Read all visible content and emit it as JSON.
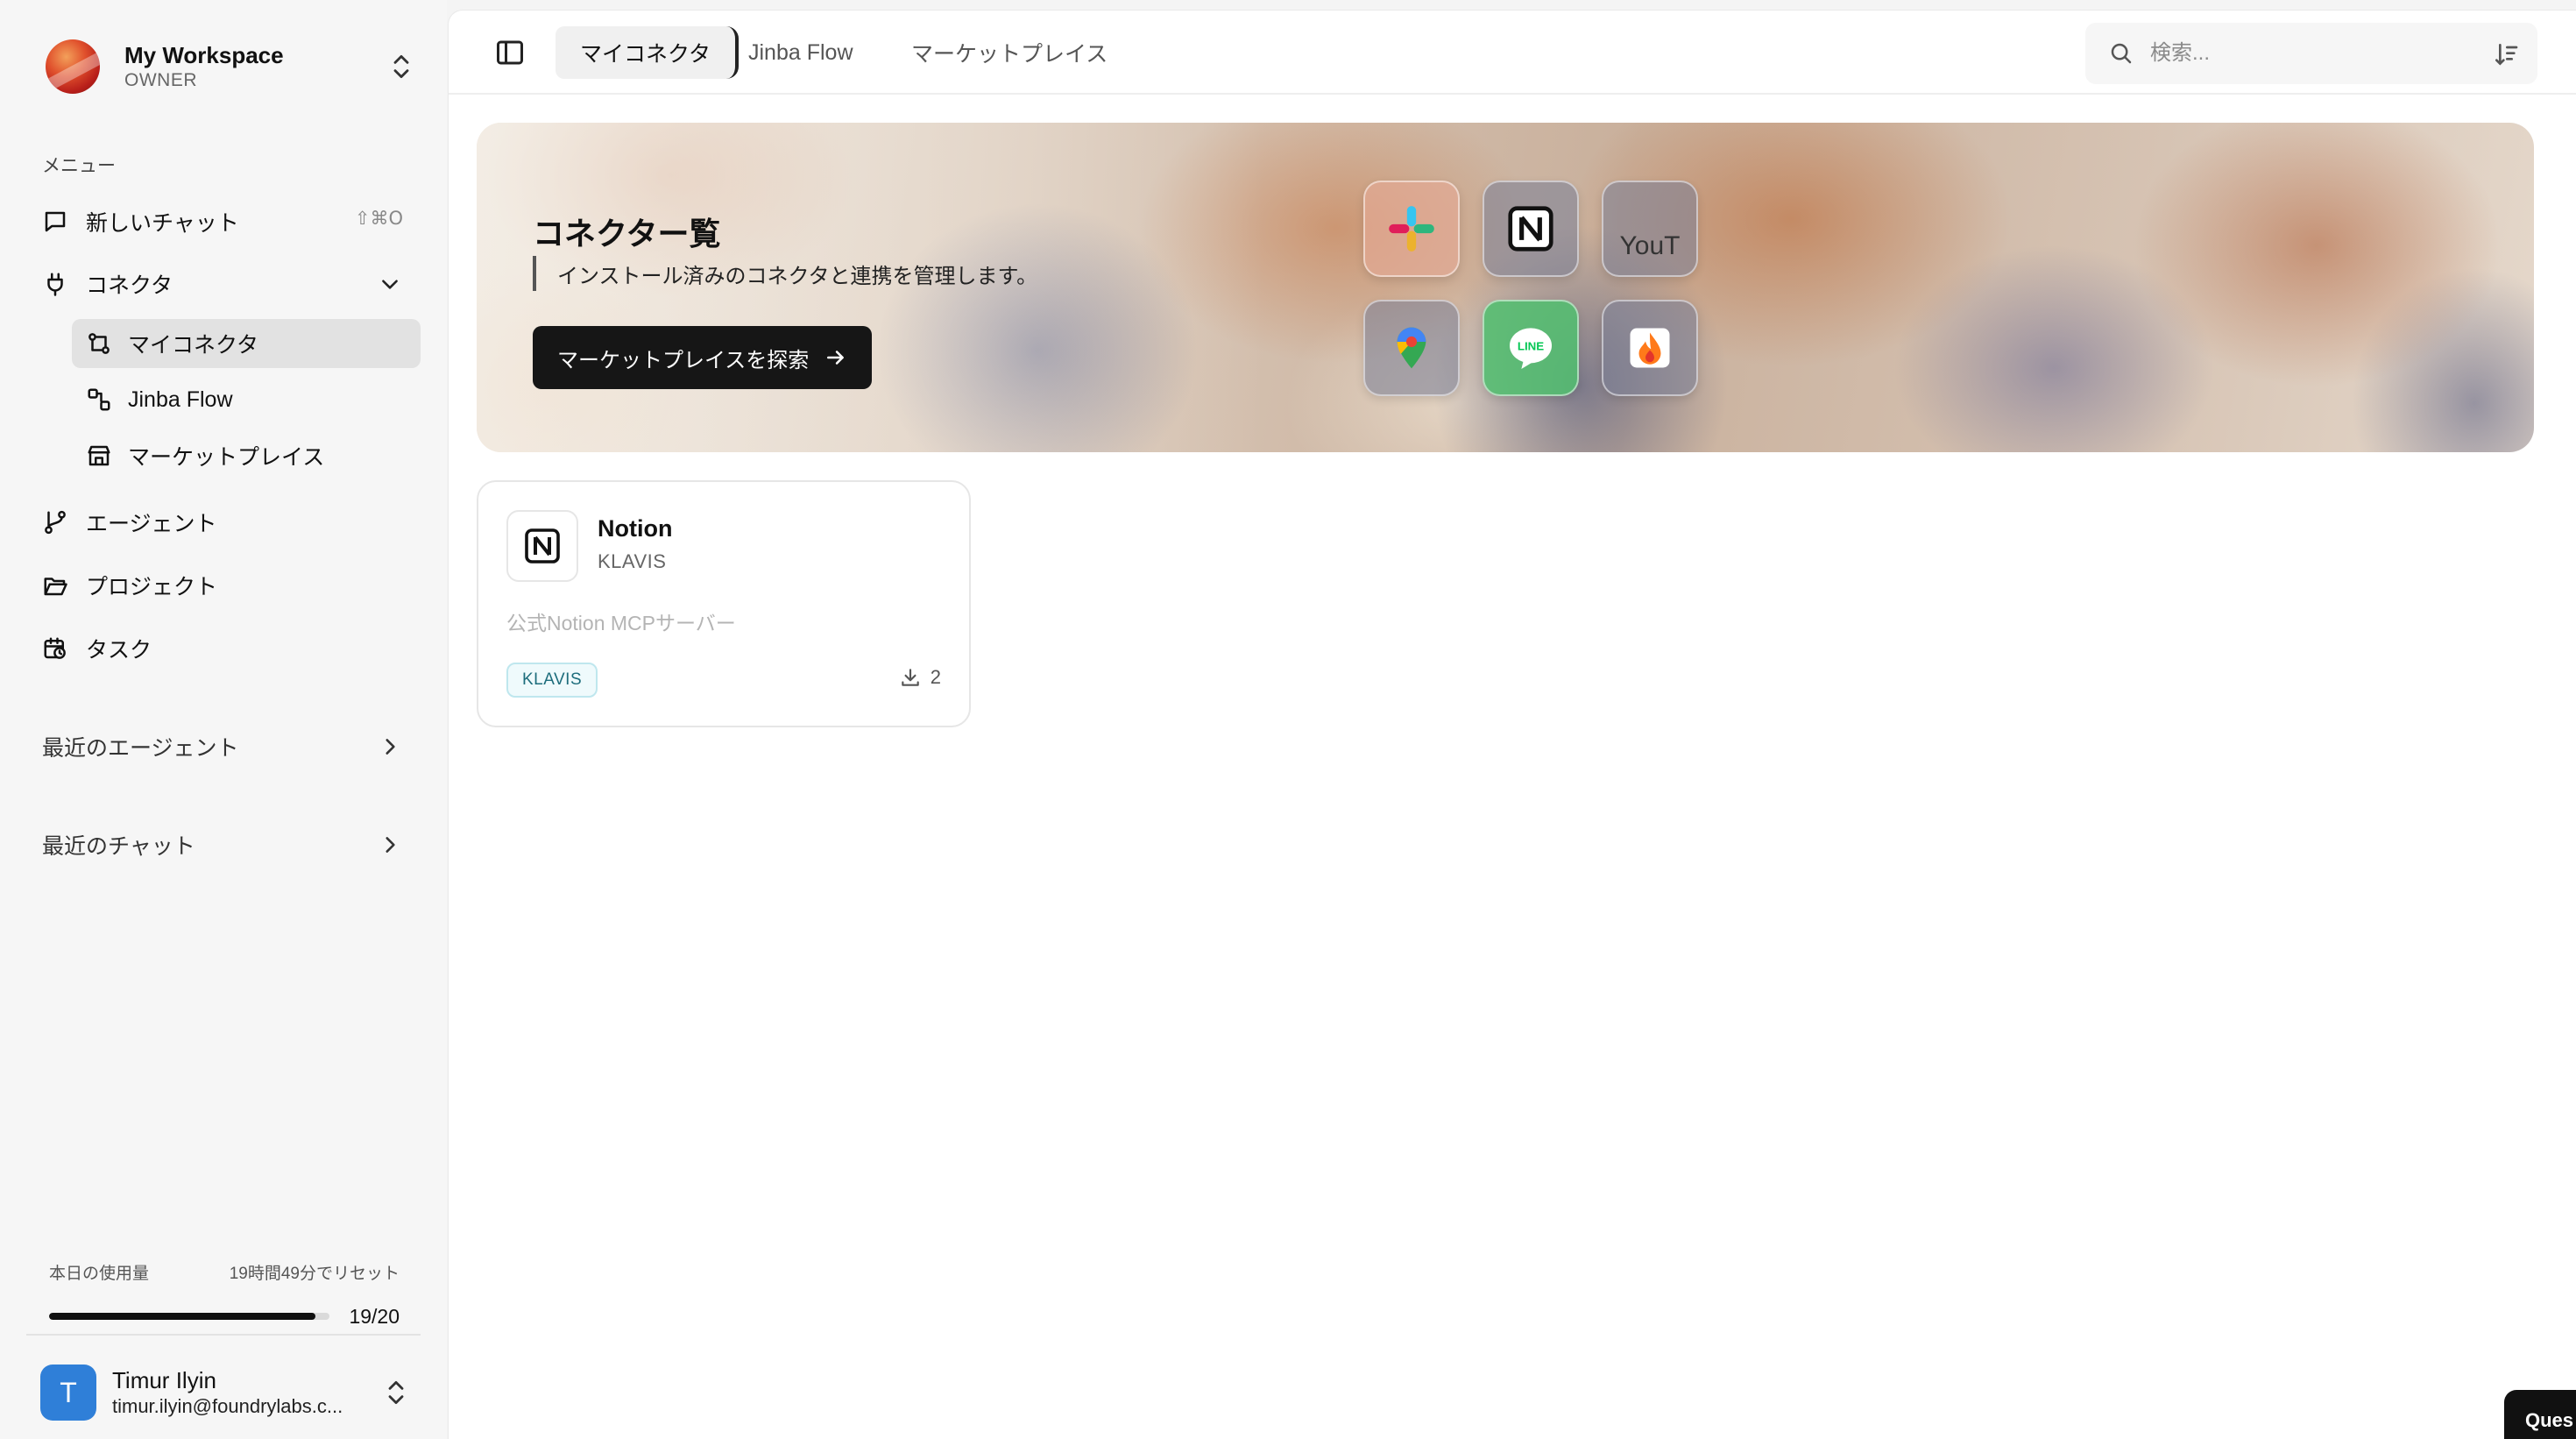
{
  "workspace": {
    "name": "My Workspace",
    "role": "OWNER"
  },
  "sidebar": {
    "menu_heading": "メニュー",
    "new_chat": {
      "label": "新しいチャット",
      "shortcut": "⇧⌘O"
    },
    "connectors": {
      "label": "コネクタ",
      "sub_items": [
        {
          "label": "マイコネクタ",
          "active": true
        },
        {
          "label": "Jinba Flow"
        },
        {
          "label": "マーケットプレイス"
        }
      ]
    },
    "agents": "エージェント",
    "projects": "プロジェクト",
    "tasks": "タスク",
    "recent_agents": "最近のエージェント",
    "recent_chats": "最近のチャット"
  },
  "usage": {
    "label": "本日の使用量",
    "reset": "19時間49分でリセット",
    "count": "19/20",
    "fraction": 0.95
  },
  "user": {
    "initial": "T",
    "name": "Timur Ilyin",
    "email": "timur.ilyin@foundrylabs.c..."
  },
  "tabs": [
    "マイコネクタ",
    "Jinba Flow",
    "マーケットプレイス"
  ],
  "search": {
    "placeholder": "検索..."
  },
  "hero": {
    "title": "コネクター覧",
    "subtitle": "インストール済みのコネクタと連携を管理します。",
    "button": "マーケットプレイスを探索",
    "icons": [
      "slack-icon",
      "notion-icon",
      "youtube-icon",
      "google-maps-icon",
      "line-icon",
      "firebase-icon"
    ],
    "broken_image_text": "YouT"
  },
  "card": {
    "title": "Notion",
    "provider": "KLAVIS",
    "description": "公式Notion MCPサーバー",
    "badge": "KLAVIS",
    "downloads": "2"
  },
  "help_button": "Ques",
  "colors": {
    "accent": "#161616",
    "badge_bg": "#effafc",
    "badge_text": "#1d6d7c",
    "avatar": "#2f7fd8"
  }
}
